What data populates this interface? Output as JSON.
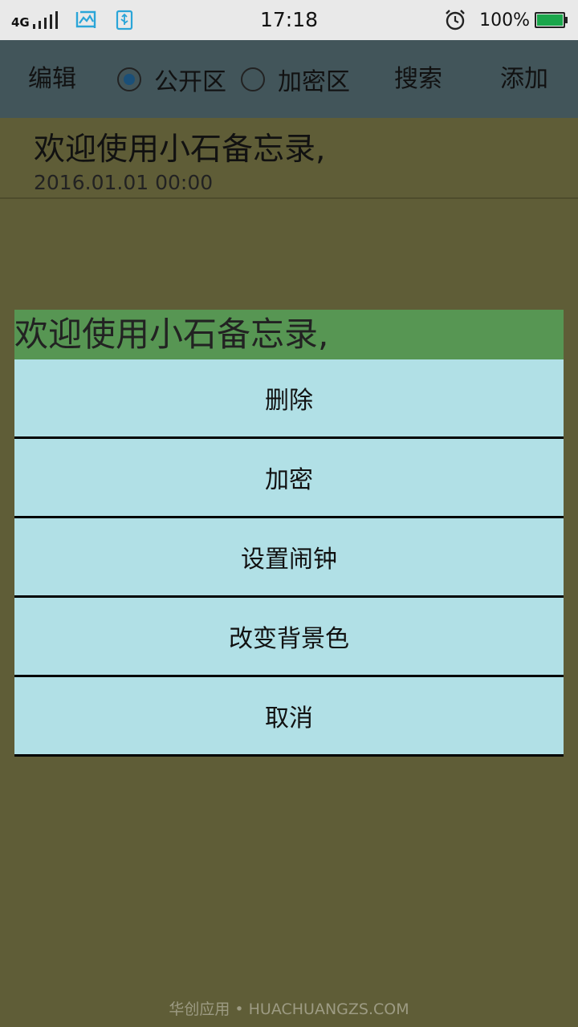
{
  "status_bar": {
    "network": "4G",
    "time": "17:18",
    "battery": "100%",
    "battery_level": 1.0,
    "icons": [
      "signal-icon",
      "screenshot-icon",
      "usb-icon",
      "alarm-icon",
      "battery-icon"
    ],
    "accent_color": "#2aa5d8"
  },
  "toolbar": {
    "edit_label": "编辑",
    "public_label": "公开区",
    "encrypted_label": "加密区",
    "search_label": "搜索",
    "add_label": "添加",
    "selected_area": "公开区"
  },
  "notes": [
    {
      "title": "欢迎使用小石备忘录,",
      "date": "2016.01.01 00:00"
    }
  ],
  "dialog": {
    "title": "欢迎使用小石备忘录,",
    "items": [
      {
        "label": "删除"
      },
      {
        "label": "加密"
      },
      {
        "label": "设置闹钟"
      },
      {
        "label": "改变背景色"
      },
      {
        "label": "取消"
      }
    ]
  },
  "watermark": "华创应用 • HUACHUANGZS.COM",
  "colors": {
    "background": "#5f5d37",
    "toolbar": "#42555a",
    "dialog_title": "#579653",
    "menu_item": "#b1e0e6",
    "radio_checked": "#1a4f78",
    "battery": "#1aa64b"
  }
}
